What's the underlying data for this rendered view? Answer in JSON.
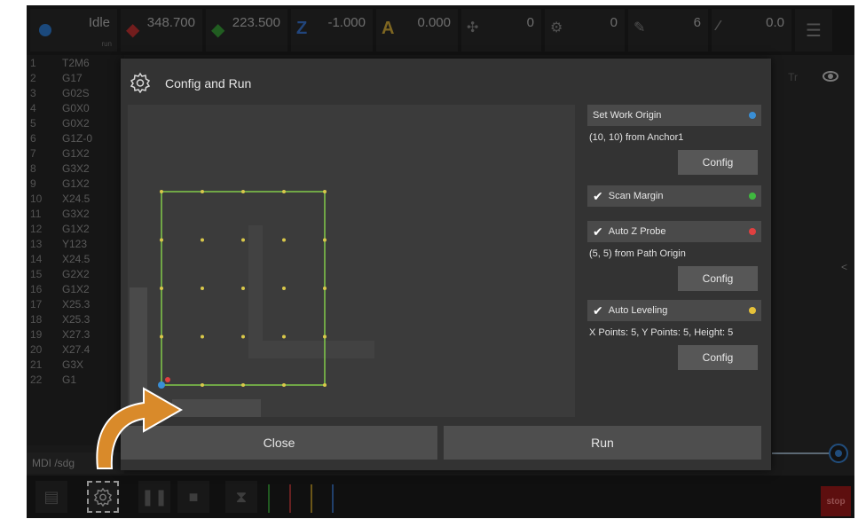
{
  "topbar": {
    "state": "Idle",
    "state_sub": "run",
    "x_value": "348.700",
    "y_value": "223.500",
    "z_label": "Z",
    "z_value": "-1.000",
    "a_label": "A",
    "a_value": "0.000",
    "c1_value": "0",
    "c2_value": "0",
    "c3_value": "6",
    "c4_value": "0.0"
  },
  "gcode": {
    "lines": [
      {
        "n": "1",
        "c": "T2M6"
      },
      {
        "n": "2",
        "c": "G17"
      },
      {
        "n": "3",
        "c": "G02S"
      },
      {
        "n": "4",
        "c": "G0X0"
      },
      {
        "n": "5",
        "c": "G0X2"
      },
      {
        "n": "6",
        "c": "G1Z-0"
      },
      {
        "n": "7",
        "c": "G1X2"
      },
      {
        "n": "8",
        "c": "G3X2"
      },
      {
        "n": "9",
        "c": "G1X2"
      },
      {
        "n": "10",
        "c": "X24.5"
      },
      {
        "n": "11",
        "c": "G3X2"
      },
      {
        "n": "12",
        "c": "G1X2"
      },
      {
        "n": "13",
        "c": "Y123"
      },
      {
        "n": "14",
        "c": "X24.5"
      },
      {
        "n": "15",
        "c": "G2X2"
      },
      {
        "n": "16",
        "c": "G1X2"
      },
      {
        "n": "17",
        "c": "X25.3"
      },
      {
        "n": "18",
        "c": "X25.3"
      },
      {
        "n": "19",
        "c": "X27.3"
      },
      {
        "n": "20",
        "c": "X27.4"
      },
      {
        "n": "21",
        "c": "G3X"
      },
      {
        "n": "22",
        "c": "G1"
      }
    ]
  },
  "right_panel": {
    "tr_label": "Tr"
  },
  "mdi": {
    "label": "MDI /sdg"
  },
  "modal": {
    "title": "Config and Run",
    "options": {
      "work_origin": {
        "label": "Set Work Origin",
        "desc": "(10, 10) from Anchor1",
        "button": "Config",
        "color": "#3a8fd6"
      },
      "scan_margin": {
        "label": "Scan Margin",
        "color": "#3fb93f"
      },
      "auto_z_probe": {
        "label": "Auto Z Probe",
        "desc": "(5, 5) from Path Origin",
        "button": "Config",
        "color": "#e04040"
      },
      "auto_leveling": {
        "label": "Auto Leveling",
        "desc": "X Points: 5, Y Points: 5, Height: 5",
        "button": "Config",
        "color": "#e6c23a"
      }
    },
    "close_label": "Close",
    "run_label": "Run"
  },
  "bottombar": {
    "stop_label": "stop"
  },
  "colors": {
    "scan_box": "#7dc24a",
    "probe_points": "#d9c84a",
    "origin_marker": "#3a8fd6",
    "probe_marker": "#e04040",
    "hint_arrow": "#d98a2a"
  }
}
